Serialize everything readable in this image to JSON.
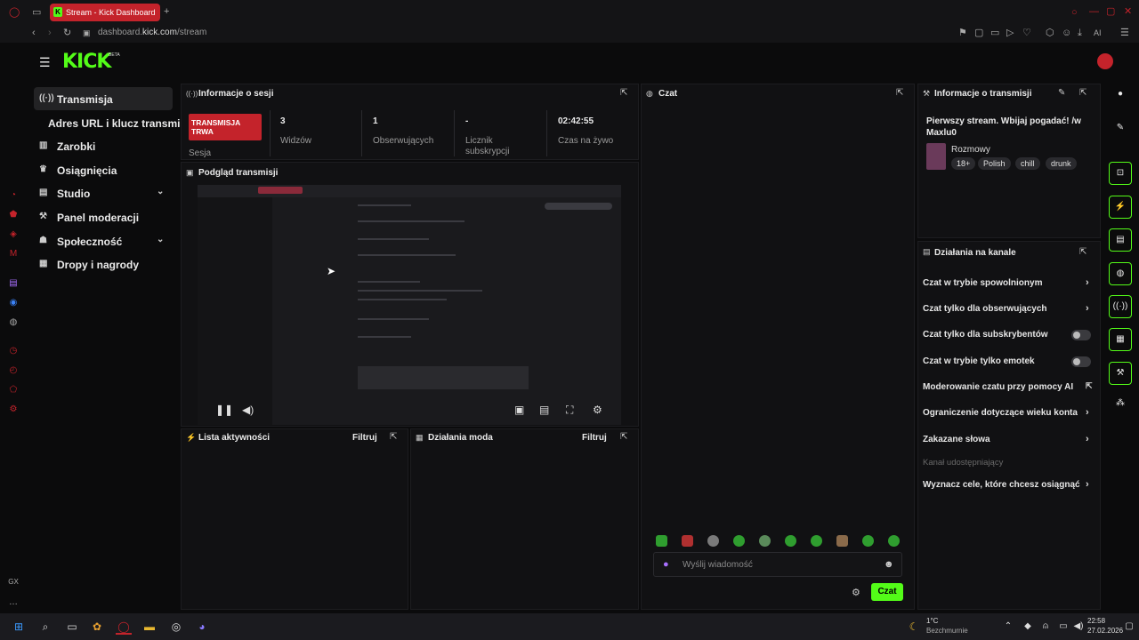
{
  "browser": {
    "tab_title": "Stream - Kick Dashboard",
    "tab_icon": "K",
    "url_prefix": "dashboard.",
    "url_domain": "kick.com",
    "url_path": "/stream",
    "ai_label": "AI"
  },
  "header": {
    "logo": "KICK",
    "beta": "BETA"
  },
  "sidebar": {
    "items": [
      {
        "label": "Transmisja",
        "icon": "broadcast-icon"
      },
      {
        "label": "Adres URL i klucz transmisji",
        "icon": ""
      },
      {
        "label": "Zarobki",
        "icon": "chart-icon"
      },
      {
        "label": "Osiągnięcia",
        "icon": "trophy-icon"
      },
      {
        "label": "Studio",
        "icon": "studio-icon"
      },
      {
        "label": "Panel moderacji",
        "icon": "wrench-icon"
      },
      {
        "label": "Społeczność",
        "icon": "people-icon"
      },
      {
        "label": "Dropy i nagrody",
        "icon": "gift-icon"
      }
    ]
  },
  "session": {
    "title": "Informacje o sesji",
    "status": "TRANSMISJA TRWA",
    "status_sub": "Sesja",
    "stats": [
      {
        "value": "3",
        "label": "Widzów"
      },
      {
        "value": "1",
        "label": "Obserwujących"
      },
      {
        "value": "-",
        "label": "Licznik subskrypcji"
      },
      {
        "value": "02:42:55",
        "label": "Czas na żywo"
      }
    ]
  },
  "preview": {
    "title": "Podgląd transmisji"
  },
  "activity": {
    "title": "Lista aktywności",
    "filter": "Filtruj"
  },
  "modactions": {
    "title": "Działania moda",
    "filter": "Filtruj"
  },
  "chat": {
    "title": "Czat",
    "placeholder": "Wyślij wiadomość",
    "send": "Czat"
  },
  "stream_info": {
    "title": "Informacje o transmisji",
    "stream_title": "Pierwszy stream. Wbijaj pogadać! /w Maxlu0",
    "category": "Rozmowy",
    "tags": [
      "18+",
      "Polish",
      "chill",
      "drunk"
    ]
  },
  "channel_actions": {
    "title": "Działania na kanale",
    "items": [
      {
        "label": "Czat w trybie spowolnionym",
        "control": "arrow"
      },
      {
        "label": "Czat tylko dla obserwujących",
        "control": "arrow"
      },
      {
        "label": "Czat tylko dla subskrybentów",
        "control": "toggle"
      },
      {
        "label": "Czat w trybie tylko emotek",
        "control": "toggle"
      },
      {
        "label": "Moderowanie czatu przy pomocy AI",
        "control": "external"
      },
      {
        "label": "Ograniczenie dotyczące wieku konta",
        "control": "arrow"
      },
      {
        "label": "Zakazane słowa",
        "control": "arrow"
      }
    ],
    "section_label": "Kanał udostępniający",
    "goal_item": "Wyznacz cele, które chcesz osiągnąć"
  },
  "taskbar": {
    "temp": "1°C",
    "weather": "Bezchmurnie",
    "time": "22:58",
    "date": "27.02.2026"
  },
  "colors": {
    "accent": "#53fc18",
    "live": "#c4232b",
    "panel": "#111113"
  }
}
